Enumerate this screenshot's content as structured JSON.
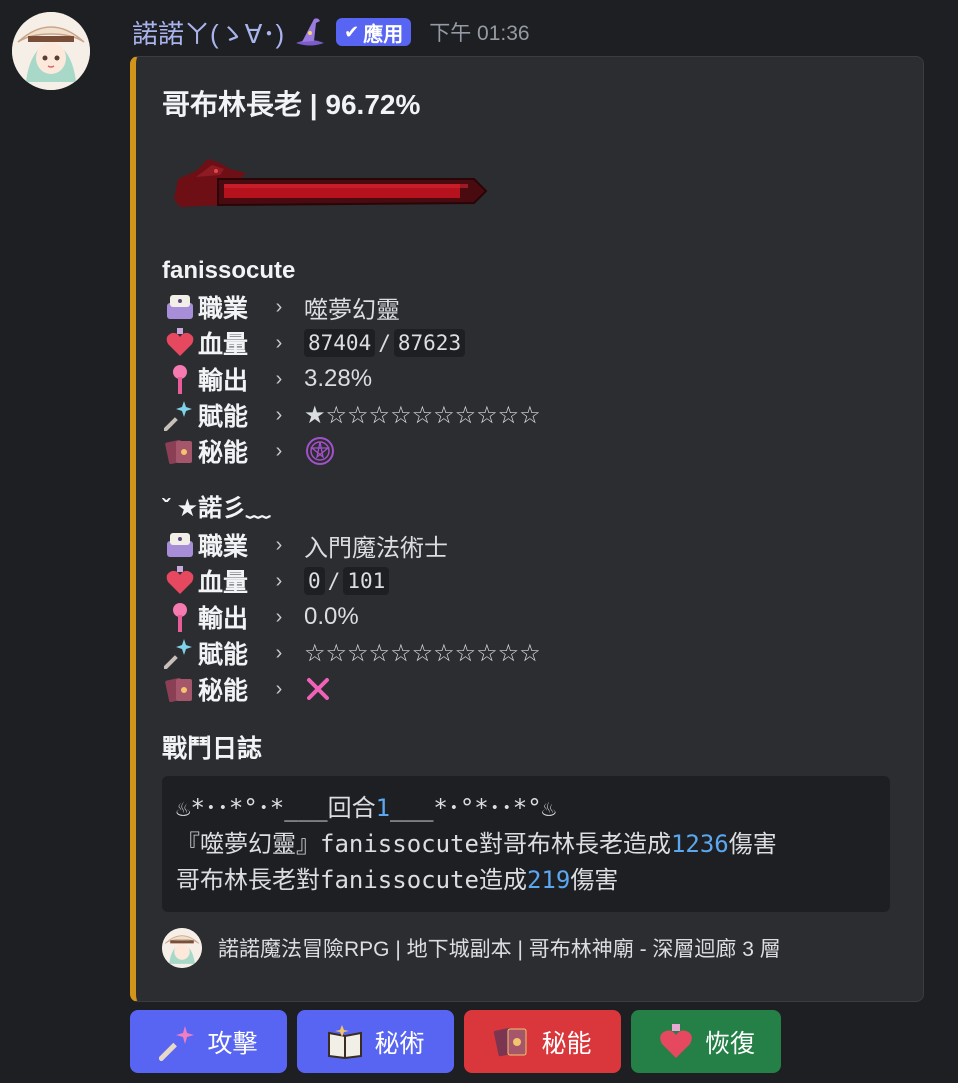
{
  "message": {
    "username": "諾諾ㄚ(ゝ∀･)",
    "badge": "應用",
    "timestamp": "下午 01:36"
  },
  "embed": {
    "title": "哥布林長老 | 96.72%",
    "boss_hp_fraction": 0.9672,
    "accent_color": "#d3941a",
    "players": [
      {
        "name": "fanissocute",
        "rows": {
          "job_label": "職業",
          "job_value": "噬夢幻靈",
          "hp_label": "血量",
          "hp_current": "87404",
          "hp_max": "87623",
          "output_label": "輸出",
          "output_value": "3.28%",
          "talent_label": "賦能",
          "talent_stars": "★☆☆☆☆☆☆☆☆☆☆",
          "secret_label": "秘能"
        }
      },
      {
        "name": "ˇ ★諾彡﹏",
        "rows": {
          "job_label": "職業",
          "job_value": "入門魔法術士",
          "hp_label": "血量",
          "hp_current": "0",
          "hp_max": "101",
          "output_label": "輸出",
          "output_value": "0.0%",
          "talent_label": "賦能",
          "talent_stars": "☆☆☆☆☆☆☆☆☆☆☆",
          "secret_label": "秘能"
        }
      }
    ],
    "log": {
      "title": "戰鬥日誌",
      "line1_pre": "♨*･･*°･*___回合",
      "line1_num": "1",
      "line1_post": "___*･°*･･*°♨",
      "line2_pre": "『噬夢幻靈』fanissocute對哥布林長老造成",
      "line2_num": "1236",
      "line2_post": "傷害",
      "line3_pre": "哥布林長老對fanissocute造成",
      "line3_num": "219",
      "line3_post": "傷害"
    },
    "footer": "諾諾魔法冒險RPG | 地下城副本 | 哥布林神廟 - 深層迴廊 3 層"
  },
  "buttons": {
    "attack": "攻擊",
    "spell": "秘術",
    "secret": "秘能",
    "heal": "恢復"
  }
}
